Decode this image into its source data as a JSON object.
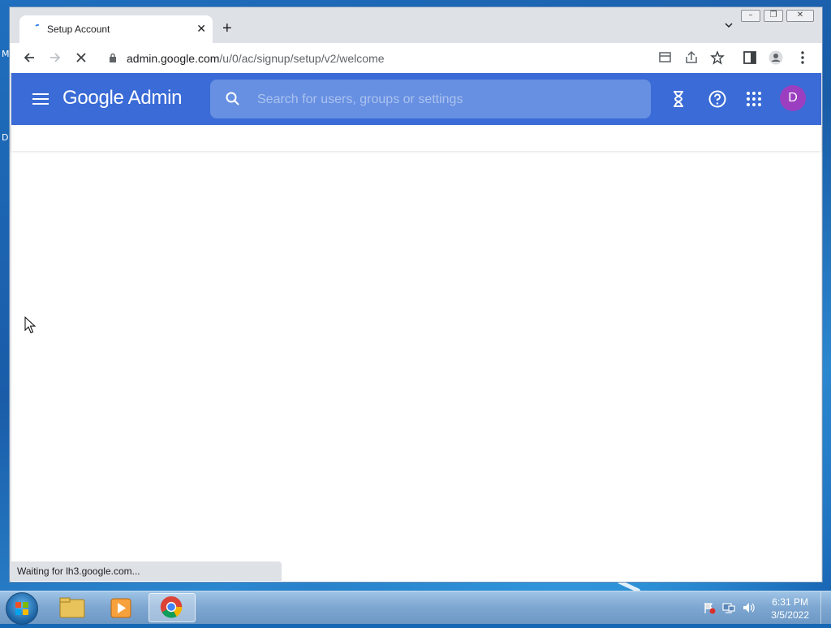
{
  "browser": {
    "tab_title": "Setup Account",
    "tab_close": "✕",
    "new_tab": "+",
    "url_host": "admin.google.com",
    "url_path": "/u/0/ac/signup/setup/v2/welcome",
    "status_text": "Waiting for lh3.google.com...",
    "window_controls": {
      "minimize": "–",
      "restore": "❐",
      "close": "✕"
    }
  },
  "admin": {
    "brand": "Google Admin",
    "search_placeholder": "Search for users, groups or settings",
    "avatar_initial": "D"
  },
  "desktop": {
    "left_letters": [
      "M",
      "D"
    ]
  },
  "taskbar": {
    "time": "6:31 PM",
    "date": "3/5/2022"
  }
}
